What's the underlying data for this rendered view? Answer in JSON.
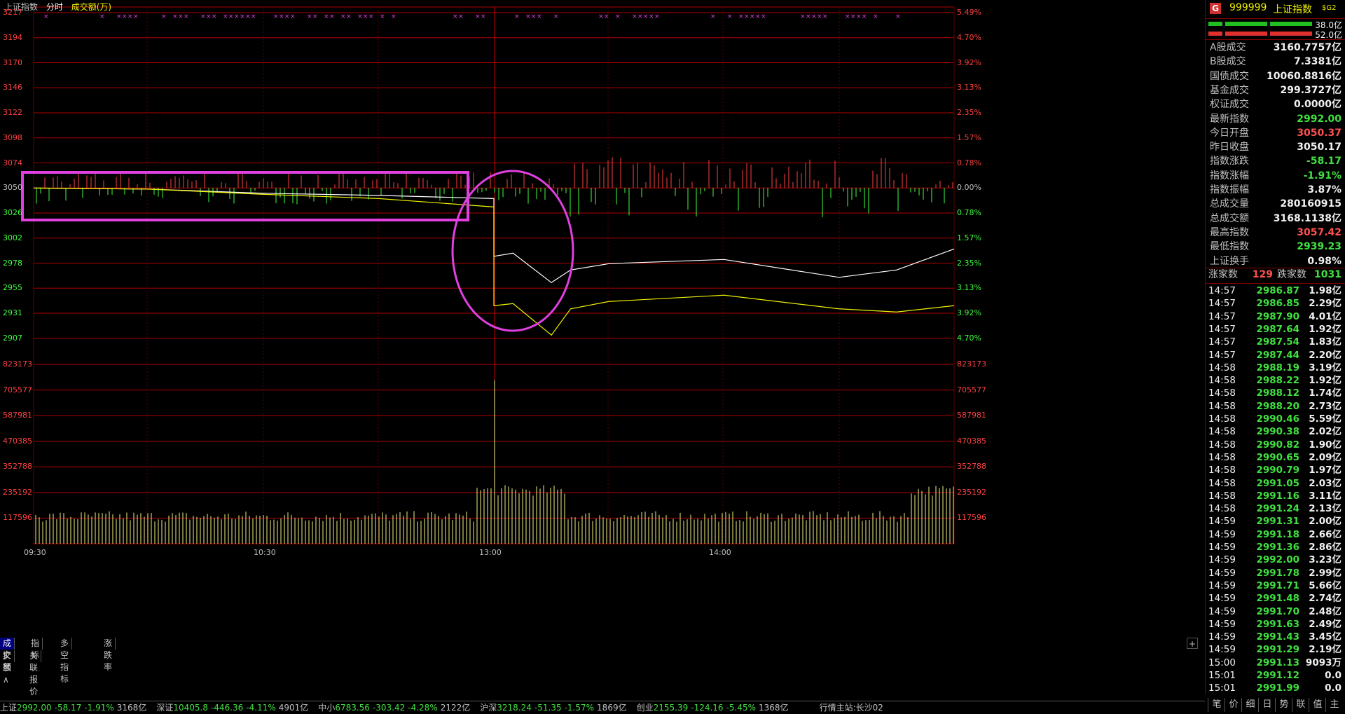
{
  "chart_header": {
    "index_name": "上证指数",
    "mode": "分时",
    "indicator": "成交额(万)"
  },
  "price_axis_left": [
    "3217",
    "3194",
    "3170",
    "3146",
    "3122",
    "3098",
    "3074",
    "3050",
    "3026",
    "3002",
    "2978",
    "2955",
    "2931",
    "2907"
  ],
  "price_axis_right": [
    "5.49%",
    "4.70%",
    "3.92%",
    "3.13%",
    "2.35%",
    "1.57%",
    "0.78%",
    "0.00%",
    "0.78%",
    "1.57%",
    "2.35%",
    "3.13%",
    "3.92%",
    "4.70%"
  ],
  "volume_axis": [
    "823173",
    "705577",
    "587981",
    "470385",
    "352788",
    "235192",
    "117596"
  ],
  "time_axis": [
    "09:30",
    "10:30",
    "13:00",
    "14:00"
  ],
  "colors": {
    "up": "#ff4040",
    "down": "#40ff40",
    "index_line": "#ffffff",
    "avg_line": "#f0f000",
    "grid": "#b00000",
    "highlight": "#e040e0"
  },
  "chart_data": {
    "type": "line",
    "title": "上证指数",
    "ylim": [
      2907,
      3217
    ],
    "baseline": 3050.17,
    "series": [
      {
        "name": "index",
        "x": [
          "09:30",
          "10:00",
          "10:30",
          "11:00",
          "11:30",
          "13:00",
          "13:05",
          "13:15",
          "13:20",
          "13:30",
          "14:00",
          "14:30",
          "14:45",
          "15:00"
        ],
        "values": [
          3050,
          3049,
          3045,
          3043,
          3040,
          2985,
          2988,
          2960,
          2972,
          2978,
          2982,
          2965,
          2972,
          2992
        ]
      },
      {
        "name": "avg",
        "x": [
          "09:30",
          "10:00",
          "10:30",
          "11:00",
          "11:30",
          "13:00",
          "13:05",
          "13:15",
          "13:20",
          "13:30",
          "14:00",
          "14:30",
          "14:45",
          "15:00"
        ],
        "values": [
          3050,
          3049,
          3044,
          3040,
          3032,
          2938,
          2940,
          2910,
          2935,
          2942,
          2948,
          2935,
          2932,
          2938
        ]
      }
    ],
    "volume": {
      "ylim": [
        0,
        823173
      ],
      "peak_time": "13:00",
      "peak_value": 750000
    }
  },
  "quote": {
    "badge": "G",
    "code": "999999",
    "name": "上证指数",
    "tag": "$G2",
    "bar1": "38.0亿",
    "bar2": "52.0亿",
    "rows": [
      {
        "k": "A股成交",
        "v": "3160.7757亿",
        "c": "white"
      },
      {
        "k": "B股成交",
        "v": "7.3381亿",
        "c": "white"
      },
      {
        "k": "国债成交",
        "v": "10060.8816亿",
        "c": "white"
      },
      {
        "k": "基金成交",
        "v": "299.3727亿",
        "c": "white"
      },
      {
        "k": "权证成交",
        "v": "0.0000亿",
        "c": "white"
      },
      {
        "k": "最新指数",
        "v": "2992.00",
        "c": "green"
      },
      {
        "k": "今日开盘",
        "v": "3050.37",
        "c": "red"
      },
      {
        "k": "昨日收盘",
        "v": "3050.17",
        "c": "white"
      },
      {
        "k": "指数涨跌",
        "v": "-58.17",
        "c": "green"
      },
      {
        "k": "指数涨幅",
        "v": "-1.91%",
        "c": "green"
      },
      {
        "k": "指数振幅",
        "v": "3.87%",
        "c": "white"
      },
      {
        "k": "总成交量",
        "v": "280160915",
        "c": "white"
      },
      {
        "k": "总成交额",
        "v": "3168.1138亿",
        "c": "white"
      },
      {
        "k": "最高指数",
        "v": "3057.42",
        "c": "red"
      },
      {
        "k": "最低指数",
        "v": "2939.23",
        "c": "green"
      },
      {
        "k": "上证换手",
        "v": "0.98%",
        "c": "white"
      }
    ],
    "breadth": {
      "up_label": "涨家数",
      "up": "129",
      "down_label": "跌家数",
      "down": "1031"
    }
  },
  "trades": [
    {
      "t": "14:57",
      "p": "2986.87",
      "a": "1.98亿"
    },
    {
      "t": "14:57",
      "p": "2986.85",
      "a": "2.29亿"
    },
    {
      "t": "14:57",
      "p": "2987.90",
      "a": "4.01亿"
    },
    {
      "t": "14:57",
      "p": "2987.64",
      "a": "1.92亿"
    },
    {
      "t": "14:57",
      "p": "2987.54",
      "a": "1.83亿"
    },
    {
      "t": "14:57",
      "p": "2987.44",
      "a": "2.20亿"
    },
    {
      "t": "14:58",
      "p": "2988.19",
      "a": "3.19亿"
    },
    {
      "t": "14:58",
      "p": "2988.22",
      "a": "1.92亿"
    },
    {
      "t": "14:58",
      "p": "2988.12",
      "a": "1.74亿"
    },
    {
      "t": "14:58",
      "p": "2988.20",
      "a": "2.73亿"
    },
    {
      "t": "14:58",
      "p": "2990.46",
      "a": "5.59亿"
    },
    {
      "t": "14:58",
      "p": "2990.38",
      "a": "2.02亿"
    },
    {
      "t": "14:58",
      "p": "2990.82",
      "a": "1.90亿"
    },
    {
      "t": "14:58",
      "p": "2990.65",
      "a": "2.09亿"
    },
    {
      "t": "14:58",
      "p": "2990.79",
      "a": "1.97亿"
    },
    {
      "t": "14:58",
      "p": "2991.05",
      "a": "2.03亿"
    },
    {
      "t": "14:58",
      "p": "2991.16",
      "a": "3.11亿"
    },
    {
      "t": "14:58",
      "p": "2991.24",
      "a": "2.13亿"
    },
    {
      "t": "14:59",
      "p": "2991.31",
      "a": "2.00亿"
    },
    {
      "t": "14:59",
      "p": "2991.18",
      "a": "2.66亿"
    },
    {
      "t": "14:59",
      "p": "2991.36",
      "a": "2.86亿"
    },
    {
      "t": "14:59",
      "p": "2992.00",
      "a": "3.23亿"
    },
    {
      "t": "14:59",
      "p": "2991.78",
      "a": "2.99亿"
    },
    {
      "t": "14:59",
      "p": "2991.71",
      "a": "5.66亿"
    },
    {
      "t": "14:59",
      "p": "2991.48",
      "a": "2.74亿"
    },
    {
      "t": "14:59",
      "p": "2991.70",
      "a": "2.48亿"
    },
    {
      "t": "14:59",
      "p": "2991.63",
      "a": "2.49亿"
    },
    {
      "t": "14:59",
      "p": "2991.43",
      "a": "3.45亿"
    },
    {
      "t": "14:59",
      "p": "2991.29",
      "a": "2.19亿"
    },
    {
      "t": "15:00",
      "p": "2991.13",
      "a": "9093万"
    },
    {
      "t": "15:01",
      "p": "2991.12",
      "a": "0.0"
    },
    {
      "t": "15:01",
      "p": "2991.99",
      "a": "0.0"
    }
  ],
  "bottom_tabs": [
    "成交额",
    "指标",
    "多空指标",
    "涨跌率"
  ],
  "bottom_tabs2": [
    "扩展∧",
    "关联报价"
  ],
  "rp_tabs": [
    "笔",
    "价",
    "细",
    "日",
    "势",
    "联",
    "值",
    "主"
  ],
  "zoom": {
    "plus": "+",
    "minus": "-"
  },
  "ticker": [
    {
      "name": "上证",
      "val": "2992.00",
      "chg": "-58.17",
      "pct": "-1.91%",
      "amt": "3168亿"
    },
    {
      "name": "深证",
      "val": "10405.8",
      "chg": "-446.36",
      "pct": "-4.11%",
      "amt": "4901亿"
    },
    {
      "name": "中小",
      "val": "6783.56",
      "chg": "-303.42",
      "pct": "-4.28%",
      "amt": "2122亿"
    },
    {
      "name": "沪深",
      "val": "3218.24",
      "chg": "-51.35",
      "pct": "-1.57%",
      "amt": "1869亿"
    },
    {
      "name": "创业",
      "val": "2155.39",
      "chg": "-124.16",
      "pct": "-5.45%",
      "amt": "1368亿"
    }
  ],
  "ticker_status": "行情主站:长沙02"
}
